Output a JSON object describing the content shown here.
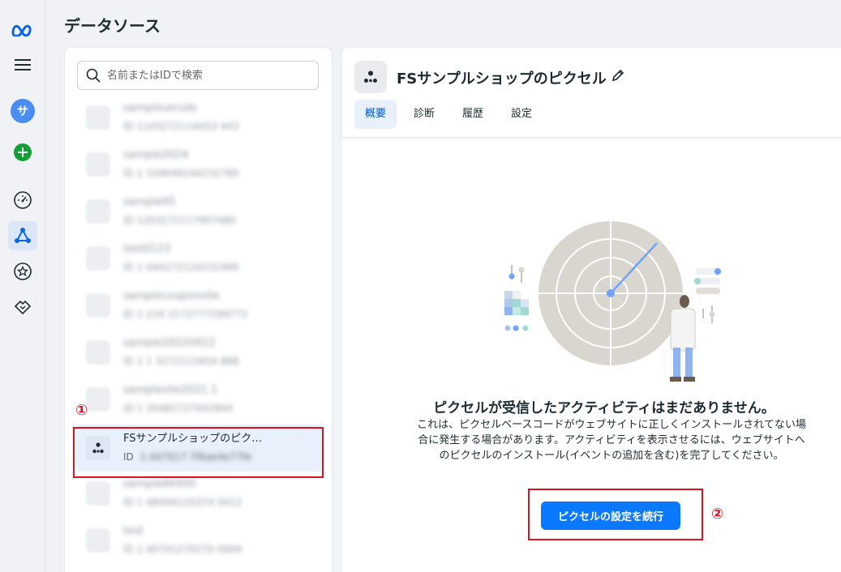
{
  "nav": {
    "items": [
      {
        "name": "meta-logo-icon"
      },
      {
        "name": "menu-icon"
      },
      {
        "name": "account-avatar",
        "label": "サ"
      },
      {
        "name": "create-plus-icon"
      },
      {
        "name": "dashboard-gauge-icon"
      },
      {
        "name": "data-sources-icon"
      },
      {
        "name": "favorites-star-icon"
      },
      {
        "name": "partner-handshake-icon"
      }
    ],
    "accent_color": "#0a78ff"
  },
  "page": {
    "title": "データソース"
  },
  "search": {
    "placeholder": "名前またはIDで検索",
    "value": ""
  },
  "datasources": [
    {
      "name": "sampleusruds",
      "id": "ID 1143272114453 443"
    },
    {
      "name": "sample2024",
      "id": "ID 1 104049244232789"
    },
    {
      "name": "sampleA5",
      "id": "ID 1203272117907480"
    },
    {
      "name": "test0123",
      "id": "ID 1 044272124231999"
    },
    {
      "name": "samplecouponsite",
      "id": "ID 1 234 2172777299772"
    },
    {
      "name": "sample20220412",
      "id": "ID 1 1 3272123454 888"
    },
    {
      "name": "samplesite2021 1",
      "id": "ID 1 20482727042844"
    },
    {
      "name": "FSサンプルショップのピク…",
      "id_label": "ID",
      "id": "1 047017 7f6ae4e77fe"
    },
    {
      "name": "sampleA6400",
      "id": "ID 1 48494120374 0412"
    },
    {
      "name": "test",
      "id": "ID 1 40741270270 0004"
    }
  ],
  "annotations": {
    "marker_1": "①",
    "marker_2": "②"
  },
  "detail": {
    "title": "FSサンプルショップのピクセル",
    "tabs": [
      "概要",
      "診断",
      "履歴",
      "設定"
    ],
    "active_tab": "概要",
    "empty_title": "ピクセルが受信したアクティビティはまだありません。",
    "empty_description": "これは、ピクセルベースコードがウェブサイトに正しくインストールされてない場合に発生する場合があります。アクティビティを表示させるには、ウェブサイトへのピクセルのインストール(イベントの追加を含む)を完了してください。",
    "cta_label": "ピクセルの設定を続行"
  }
}
